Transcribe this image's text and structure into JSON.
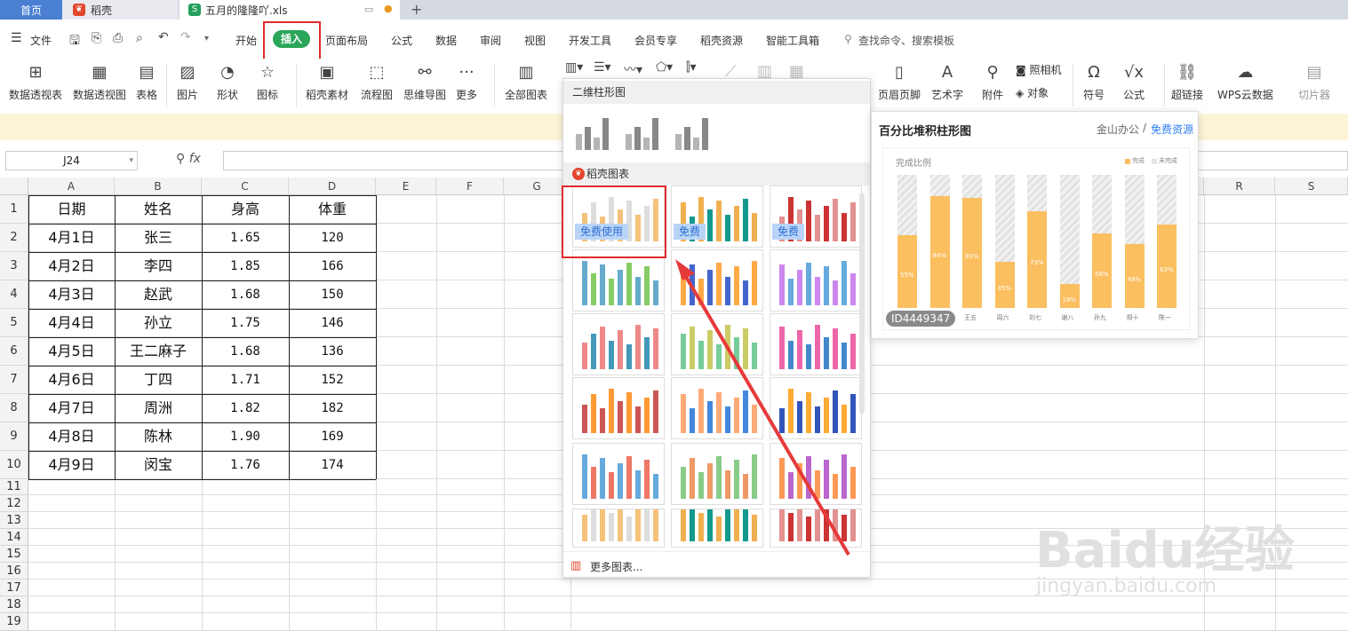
{
  "tabs": {
    "home": "首页",
    "daoke": "稻壳",
    "file": "五月的隆隆吖.xls"
  },
  "menu": {
    "file": "文件",
    "items": [
      "开始",
      "插入",
      "页面布局",
      "公式",
      "数据",
      "审阅",
      "视图",
      "开发工具",
      "会员专享",
      "稻壳资源",
      "智能工具箱"
    ],
    "search": "查找命令、搜索模板"
  },
  "ribbon": {
    "pivot_table": "数据透视表",
    "pivot_chart": "数据透视图",
    "table": "表格",
    "picture": "图片",
    "shape": "形状",
    "icon": "图标",
    "daoke_material": "稻壳素材",
    "flowchart": "流程图",
    "mindmap": "思维导图",
    "more": "更多",
    "all_charts": "全部图表",
    "header_footer": "页眉页脚",
    "wordart": "艺术字",
    "attachment": "附件",
    "camera": "照相机",
    "object": "对象",
    "symbol": "符号",
    "formula": "公式",
    "hyperlink": "超链接",
    "wps_cloud": "WPS云数据",
    "slicer": "切片器"
  },
  "formula": {
    "cell_ref": "J24",
    "fx": "fx"
  },
  "columns": [
    "A",
    "B",
    "C",
    "D",
    "E",
    "F",
    "G",
    "R",
    "S"
  ],
  "rows": [
    "1",
    "2",
    "3",
    "4",
    "5",
    "6",
    "7",
    "8",
    "9",
    "10",
    "11",
    "12",
    "13",
    "14",
    "15",
    "16",
    "17",
    "18",
    "19"
  ],
  "table": [
    [
      "日期",
      "姓名",
      "身高",
      "体重"
    ],
    [
      "4月1日",
      "张三",
      "1.65",
      "120"
    ],
    [
      "4月2日",
      "李四",
      "1.85",
      "166"
    ],
    [
      "4月3日",
      "赵武",
      "1.68",
      "150"
    ],
    [
      "4月4日",
      "孙立",
      "1.75",
      "146"
    ],
    [
      "4月5日",
      "王二麻子",
      "1.68",
      "136"
    ],
    [
      "4月6日",
      "丁四",
      "1.71",
      "152"
    ],
    [
      "4月7日",
      "周洲",
      "1.82",
      "182"
    ],
    [
      "4月8日",
      "陈林",
      "1.90",
      "169"
    ],
    [
      "4月9日",
      "闵宝",
      "1.76",
      "174"
    ]
  ],
  "dropdown": {
    "section1": "二维柱形图",
    "section2": "稻壳图表",
    "free_use": "免费使用",
    "free": "免费",
    "more_charts": "更多图表..."
  },
  "preview": {
    "title": "百分比堆积柱形图",
    "brand": "金山办公",
    "sep": "/",
    "free_resource": "免费资源",
    "chart_title": "完成比例",
    "legend_done": "完成",
    "legend_undone": "未完成",
    "id": "ID4449347"
  },
  "chart_data": {
    "type": "bar",
    "title": "完成比例",
    "categories": [
      "",
      "",
      "王五",
      "周六",
      "刘七",
      "谢八",
      "孙九",
      "郑十",
      "陈一"
    ],
    "series": [
      {
        "name": "完成",
        "values": [
          55,
          84,
          83,
          35,
          73,
          18,
          56,
          48,
          63
        ]
      },
      {
        "name": "未完成",
        "values": [
          45,
          16,
          17,
          65,
          27,
          82,
          44,
          52,
          37
        ]
      }
    ],
    "ylim": [
      0,
      100
    ],
    "colors": {
      "done": "#fbbf60",
      "undone": "#e6e6e6"
    }
  },
  "watermark": {
    "logo": "Baidu经验",
    "url": "jingyan.baidu.com"
  }
}
